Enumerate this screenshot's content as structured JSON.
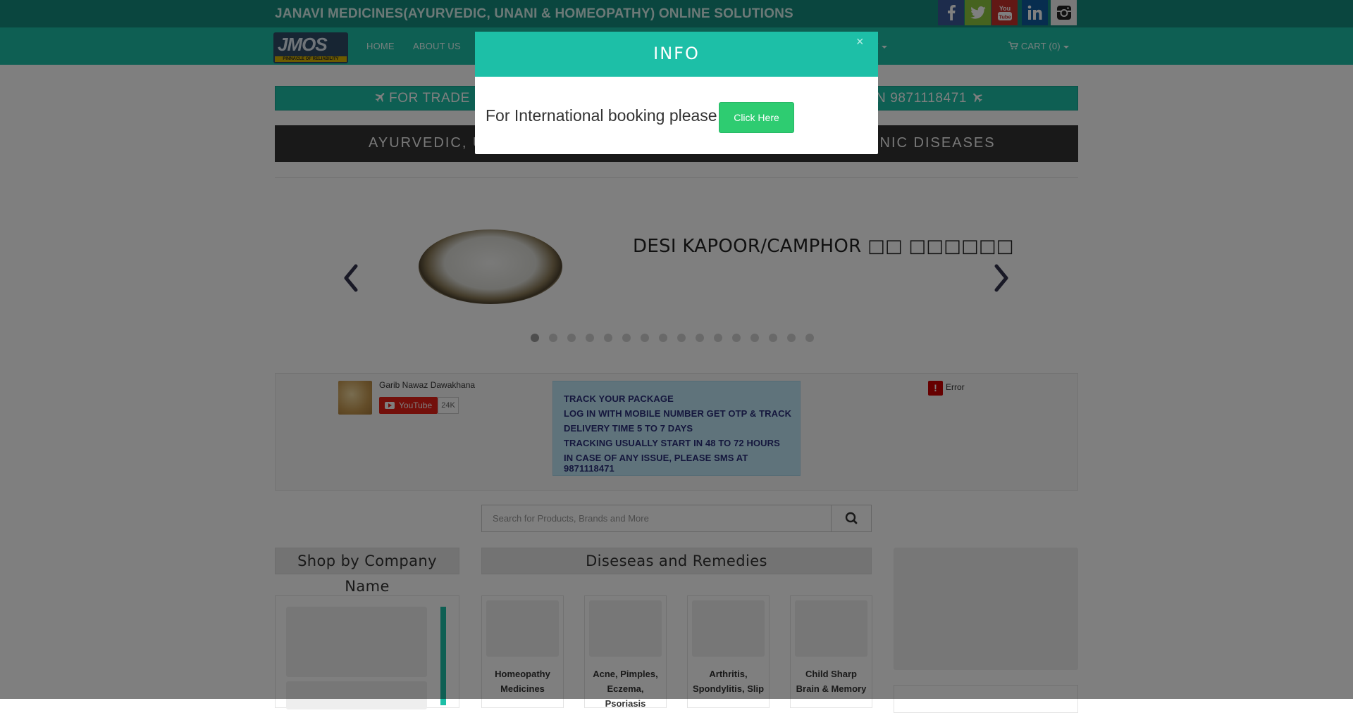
{
  "header": {
    "site_title": "JANAVI MEDICINES(AYURVEDIC, UNANI & HOMEOPATHY) ONLINE SOLUTIONS",
    "social": [
      {
        "name": "facebook",
        "color": "#3b5998",
        "icon": "facebook-icon"
      },
      {
        "name": "twitter",
        "color": "#8cc63f",
        "icon": "twitter-icon"
      },
      {
        "name": "youtube",
        "color": "#c4302b",
        "icon": "youtube-icon"
      },
      {
        "name": "linkedin",
        "color": "#0e5a9e",
        "icon": "linkedin-icon"
      },
      {
        "name": "instagram",
        "color": "#f2f2f2",
        "icon": "instagram-icon"
      }
    ]
  },
  "nav": {
    "logo_text": "JMOS",
    "logo_tagline": "PINNACLE OF RELIABILITY",
    "items": [
      "HOME",
      "ABOUT US"
    ],
    "partial_dropdown": "Y",
    "cart_label": "CART (0)"
  },
  "banners": {
    "trade_left": "FOR TRADE EN",
    "trade_right": "N 9871118471",
    "dark_left": "AYURVEDIC, UN",
    "dark_right": "ONIC DISEASES"
  },
  "carousel": {
    "slide_title": "DESI KAPOOR/CAMPHOR □□ □□□□□□",
    "dot_count": 16,
    "active_index": 0
  },
  "youtube": {
    "channel": "Garib Nawaz Dawakhana",
    "button": "YouTube",
    "count": "24K"
  },
  "tracking": {
    "lines": [
      "TRACK YOUR PACKAGE",
      "LOG IN WITH MOBILE NUMBER GET OTP & TRACK",
      "DELIVERY TIME 5 TO 7 DAYS",
      "TRACKING USUALLY START IN 48 TO 72 HOURS",
      "IN CASE OF ANY ISSUE, PLEASE SMS AT 9871118471"
    ]
  },
  "widget_error": {
    "icon": "!",
    "text": "Error"
  },
  "search": {
    "placeholder": "Search for Products, Brands and More"
  },
  "sections": {
    "company": "Shop by Company Name",
    "remedies": "Diseseas and Remedies"
  },
  "remedies": [
    {
      "label": "Homeopathy Medicines"
    },
    {
      "label": "Acne, Pimples, Eczema, Psoriasis"
    },
    {
      "label": "Arthritis, Spondylitis, Slip"
    },
    {
      "label": "Child Sharp Brain & Memory"
    }
  ],
  "modal": {
    "title": "INFO",
    "close": "×",
    "message": "For International booking please",
    "button": "Click Here"
  },
  "colors": {
    "topbar": "#148d7f",
    "nav": "#1dbfa7",
    "accent": "#1dbfa7",
    "dark_banner": "#333333",
    "track_box": "#bee6f6",
    "modal_button": "#2ecc71"
  }
}
